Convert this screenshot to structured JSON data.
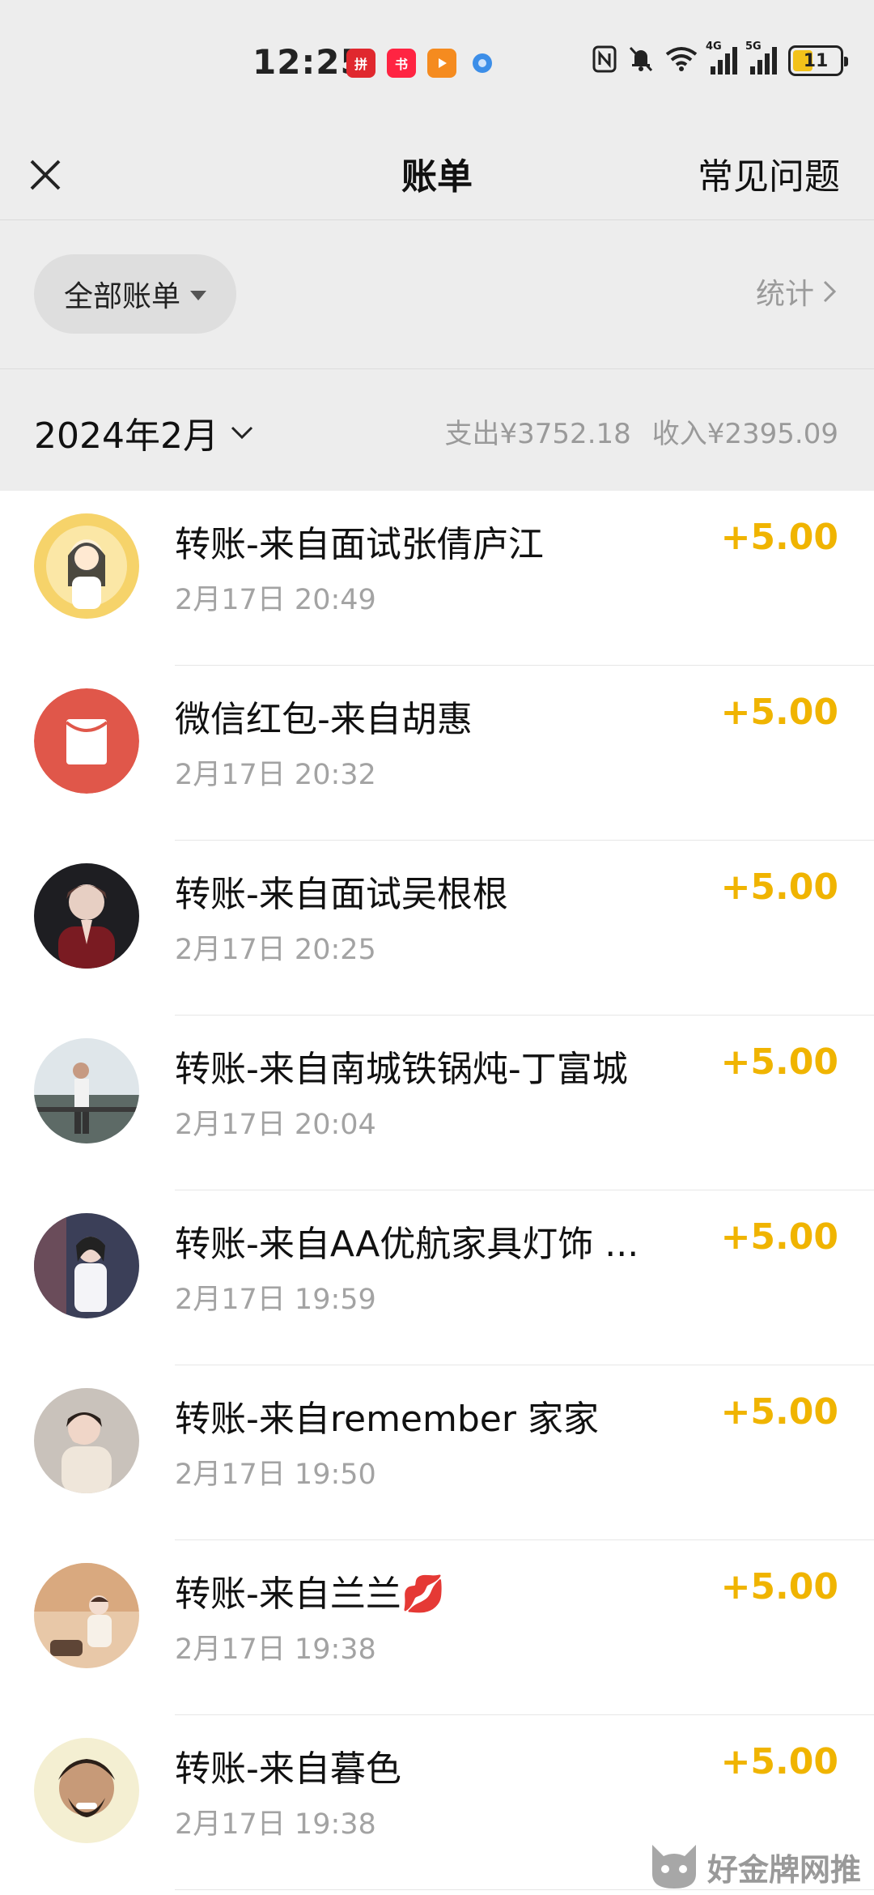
{
  "status_bar": {
    "time": "12:25",
    "signal_4g": "4G",
    "signal_5g": "5G",
    "battery": "11",
    "notification_icons": [
      "pinduoduo-icon",
      "xiaohongshu-icon",
      "video-app-icon",
      "browser-icon"
    ],
    "system_icons": [
      "nfc-icon",
      "mute-icon",
      "wifi-icon",
      "signal-4g-icon",
      "signal-5g-icon",
      "battery-icon"
    ]
  },
  "nav": {
    "title": "账单",
    "faq_label": "常见问题"
  },
  "filter": {
    "all_bills_label": "全部账单",
    "stats_label": "统计"
  },
  "month": {
    "label": "2024年2月",
    "expense": "支出¥3752.18",
    "income": "收入¥2395.09"
  },
  "bills": [
    {
      "title": "转账-来自面试张倩庐江",
      "time": "2月17日 20:49",
      "amount": "+5.00"
    },
    {
      "title": "微信红包-来自胡惠",
      "time": "2月17日 20:32",
      "amount": "+5.00"
    },
    {
      "title": "转账-来自面试吴根根",
      "time": "2月17日 20:25",
      "amount": "+5.00"
    },
    {
      "title": "转账-来自南城铁锅炖-丁富城",
      "time": "2月17日 20:04",
      "amount": "+5.00"
    },
    {
      "title": "转账-来自AA优航家具灯饰 ...",
      "time": "2月17日 19:59",
      "amount": "+5.00"
    },
    {
      "title": "转账-来自remember 家家",
      "time": "2月17日 19:50",
      "amount": "+5.00"
    },
    {
      "title": "转账-来自兰兰💋",
      "time": "2月17日 19:38",
      "amount": "+5.00"
    },
    {
      "title": "转账-来自暮色",
      "time": "2月17日 19:38",
      "amount": "+5.00"
    }
  ],
  "colors": {
    "amount": "#f0b400",
    "header_bg": "#ededed",
    "red_packet": "#e0574a"
  },
  "watermark": {
    "text": "好金牌网推"
  }
}
